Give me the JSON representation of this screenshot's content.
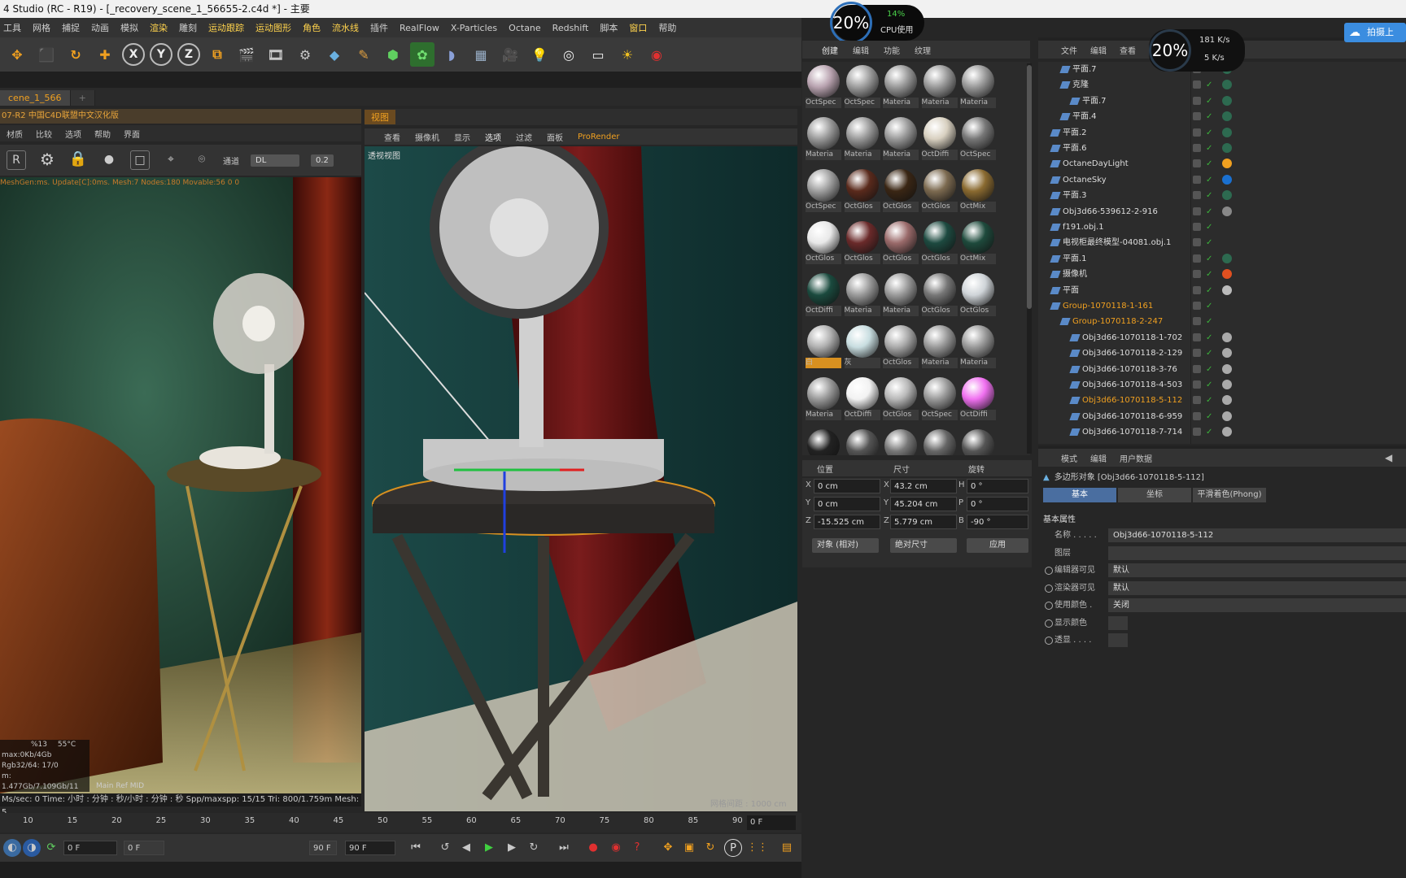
{
  "window": {
    "title": "4 Studio (RC - R19) - [_recovery_scene_1_56655-2.c4d *] - 主要"
  },
  "menubar": {
    "items": [
      "工具",
      "网格",
      "捕捉",
      "动画",
      "模拟",
      "渲染",
      "雕刻",
      "运动跟踪",
      "运动图形",
      "角色",
      "流水线",
      "插件",
      "RealFlow",
      "X-Particles",
      "Octane",
      "Redshift",
      "脚本",
      "窗口",
      "帮助"
    ]
  },
  "toolbar": {
    "axis_x": "X",
    "axis_y": "Y",
    "axis_z": "Z"
  },
  "doc_tab": {
    "label": "cene_1_566",
    "plus": "+"
  },
  "render_panel": {
    "header": "07-R2 中国C4D联盟中文汉化版",
    "menu": [
      "材质",
      "比较",
      "选项",
      "帮助",
      "界面"
    ],
    "channel_label": "通道",
    "channel_value": "DL",
    "value": "0.2",
    "overlay_line": "MeshGen:ms. Update[C]:0ms. Mesh:7 Nodes:180 Movable:56  0 0",
    "stats": {
      "gpu_pct": "%13",
      "temp": "55°C",
      "max": "max:0Kb/4Gb",
      "rgb": "Rgb32/64: 17/0",
      "mem": "m: 1.477Gb/7.109Gb/11",
      "tabs": "Main  Ref  MID"
    },
    "status": "Ms/sec: 0   Time: 小时 : 分钟 : 秒/小时 : 分钟 : 秒    Spp/maxspp: 15/15    Tri: 800/1.759m   Mesh: 5"
  },
  "viewport": {
    "tab": "视图",
    "menu": [
      "查看",
      "摄像机",
      "显示",
      "选项",
      "过滤",
      "面板",
      "ProRender"
    ],
    "label": "透视视图",
    "corner": "网格间距 : 1000 cm"
  },
  "timeline": {
    "ticks": [
      "10",
      "15",
      "20",
      "25",
      "30",
      "35",
      "40",
      "45",
      "50",
      "55",
      "60",
      "65",
      "70",
      "75",
      "80",
      "85",
      "90"
    ],
    "frame_box": "0 F",
    "start_field": "0 F",
    "range_start": "0 F",
    "range_end": "90 F",
    "end_field": "90 F"
  },
  "materials": {
    "tabs": [
      "创建",
      "编辑",
      "功能",
      "纹理"
    ],
    "items": [
      {
        "label": "OctSpec",
        "color": "#b9a3b0"
      },
      {
        "label": "OctSpec",
        "color": "#9e9e9e"
      },
      {
        "label": "Materia",
        "color": "#9a9a9a"
      },
      {
        "label": "Materia",
        "color": "#9a9a9a"
      },
      {
        "label": "Materia",
        "color": "#9a9a9a"
      },
      {
        "label": "Materia",
        "color": "#9a9a9a"
      },
      {
        "label": "Materia",
        "color": "#9a9a9a"
      },
      {
        "label": "Materia",
        "color": "#9a9a9a"
      },
      {
        "label": "OctDiffi",
        "color": "#d8d0c0"
      },
      {
        "label": "OctSpec",
        "color": "#777777"
      },
      {
        "label": "OctSpec",
        "color": "#a0a0a0"
      },
      {
        "label": "OctGlos",
        "color": "#5a2a1c"
      },
      {
        "label": "OctGlos",
        "color": "#3a2614"
      },
      {
        "label": "OctGlos",
        "color": "#7c6a50"
      },
      {
        "label": "OctMix",
        "color": "#8a6a30"
      },
      {
        "label": "OctGlos",
        "color": "#e8e8e8"
      },
      {
        "label": "OctGlos",
        "color": "#6a2a2a"
      },
      {
        "label": "OctGlos",
        "color": "#9a6a6a"
      },
      {
        "label": "OctGlos",
        "color": "#1d4a40"
      },
      {
        "label": "OctMix",
        "color": "#1e4a3c"
      },
      {
        "label": "OctDiffi",
        "color": "#1a4a3e"
      },
      {
        "label": "Materia",
        "color": "#9a9a9a"
      },
      {
        "label": "Materia",
        "color": "#9a9a9a"
      },
      {
        "label": "OctGlos",
        "color": "#777777"
      },
      {
        "label": "OctGlos",
        "color": "#cfd4d8"
      },
      {
        "label": "白",
        "color": "#b0b0b0"
      },
      {
        "label": "灰",
        "color": "#c8dde0"
      },
      {
        "label": "OctGlos",
        "color": "#aaaaaa"
      },
      {
        "label": "Materia",
        "color": "#9a9a9a"
      },
      {
        "label": "Materia",
        "color": "#9a9a9a"
      },
      {
        "label": "Materia",
        "color": "#9a9a9a"
      },
      {
        "label": "OctDiffi",
        "color": "#f2f2f2"
      },
      {
        "label": "OctGlos",
        "color": "#b8b8b8"
      },
      {
        "label": "OctSpec",
        "color": "#9a9a9a"
      },
      {
        "label": "OctDiffi",
        "color": "#f070f0"
      },
      {
        "label": "",
        "color": "#222222"
      },
      {
        "label": "",
        "color": "#555555"
      },
      {
        "label": "",
        "color": "#777777"
      },
      {
        "label": "",
        "color": "#666666"
      },
      {
        "label": "",
        "color": "#555555"
      }
    ]
  },
  "coords": {
    "headers": [
      "位置",
      "尺寸",
      "旋转"
    ],
    "rows": [
      {
        "axis": "X",
        "pos": "0 cm",
        "size_axis": "X",
        "size": "43.2 cm",
        "rot_axis": "H",
        "rot": "0 °"
      },
      {
        "axis": "Y",
        "pos": "0 cm",
        "size_axis": "Y",
        "size": "45.204 cm",
        "rot_axis": "P",
        "rot": "0 °"
      },
      {
        "axis": "Z",
        "pos": "-15.525 cm",
        "size_axis": "Z",
        "size": "5.779 cm",
        "rot_axis": "B",
        "rot": "-90 °"
      }
    ],
    "mode_select": "对象 (相对)",
    "size_select": "绝对尺寸",
    "apply": "应用"
  },
  "object_manager": {
    "tabs": [
      "文件",
      "编辑",
      "查看"
    ],
    "rows": [
      {
        "name": "平面.7",
        "indent": 1,
        "highlight": false
      },
      {
        "name": "克隆",
        "indent": 1,
        "highlight": false
      },
      {
        "name": "平面.7",
        "indent": 2,
        "highlight": false
      },
      {
        "name": "平面.4",
        "indent": 1,
        "highlight": false
      },
      {
        "name": "平面.2",
        "indent": 0,
        "highlight": false
      },
      {
        "name": "平面.6",
        "indent": 0,
        "highlight": false
      },
      {
        "name": "OctaneDayLight",
        "indent": 0,
        "highlight": false
      },
      {
        "name": "OctaneSky",
        "indent": 0,
        "highlight": false
      },
      {
        "name": "平面.3",
        "indent": 0,
        "highlight": false
      },
      {
        "name": "Obj3d66-539612-2-916",
        "indent": 0,
        "highlight": false
      },
      {
        "name": "f191.obj.1",
        "indent": 0,
        "highlight": false
      },
      {
        "name": "电视柜最终模型-04081.obj.1",
        "indent": 0,
        "highlight": false
      },
      {
        "name": "平面.1",
        "indent": 0,
        "highlight": false
      },
      {
        "name": "摄像机",
        "indent": 0,
        "highlight": false
      },
      {
        "name": "平面",
        "indent": 0,
        "highlight": false
      },
      {
        "name": "Group-1070118-1-161",
        "indent": 0,
        "highlight": true
      },
      {
        "name": "Group-1070118-2-247",
        "indent": 1,
        "highlight": true
      },
      {
        "name": "Obj3d66-1070118-1-702",
        "indent": 2,
        "highlight": false
      },
      {
        "name": "Obj3d66-1070118-2-129",
        "indent": 2,
        "highlight": false
      },
      {
        "name": "Obj3d66-1070118-3-76",
        "indent": 2,
        "highlight": false
      },
      {
        "name": "Obj3d66-1070118-4-503",
        "indent": 2,
        "highlight": false
      },
      {
        "name": "Obj3d66-1070118-5-112",
        "indent": 2,
        "highlight": true
      },
      {
        "name": "Obj3d66-1070118-6-959",
        "indent": 2,
        "highlight": false
      },
      {
        "name": "Obj3d66-1070118-7-714",
        "indent": 2,
        "highlight": false
      }
    ]
  },
  "attributes": {
    "tabs": [
      "模式",
      "编辑",
      "用户数据"
    ],
    "title": "多边形对象 [Obj3d66-1070118-5-112]",
    "subtabs": [
      "基本",
      "坐标",
      "平滑着色(Phong)"
    ],
    "section": "基本属性",
    "rows": [
      {
        "label": "名称 . . . . .",
        "value": "Obj3d66-1070118-5-112"
      },
      {
        "label": "图层",
        "value": ""
      },
      {
        "label": "编辑器可见",
        "value": "默认"
      },
      {
        "label": "渲染器可见",
        "value": "默认"
      },
      {
        "label": "使用颜色 .",
        "value": "关闭"
      },
      {
        "label": "显示颜色",
        "value": ""
      },
      {
        "label": "透显 . . . .",
        "value": ""
      }
    ]
  },
  "badges": {
    "cpu1_pct": "20%",
    "cpu1_usage": "14%",
    "cpu1_label": "CPU使用",
    "cpu2_pct": "20%",
    "net_up": "181 K/s",
    "net_down": "5 K/s",
    "share": "拍摄上"
  }
}
